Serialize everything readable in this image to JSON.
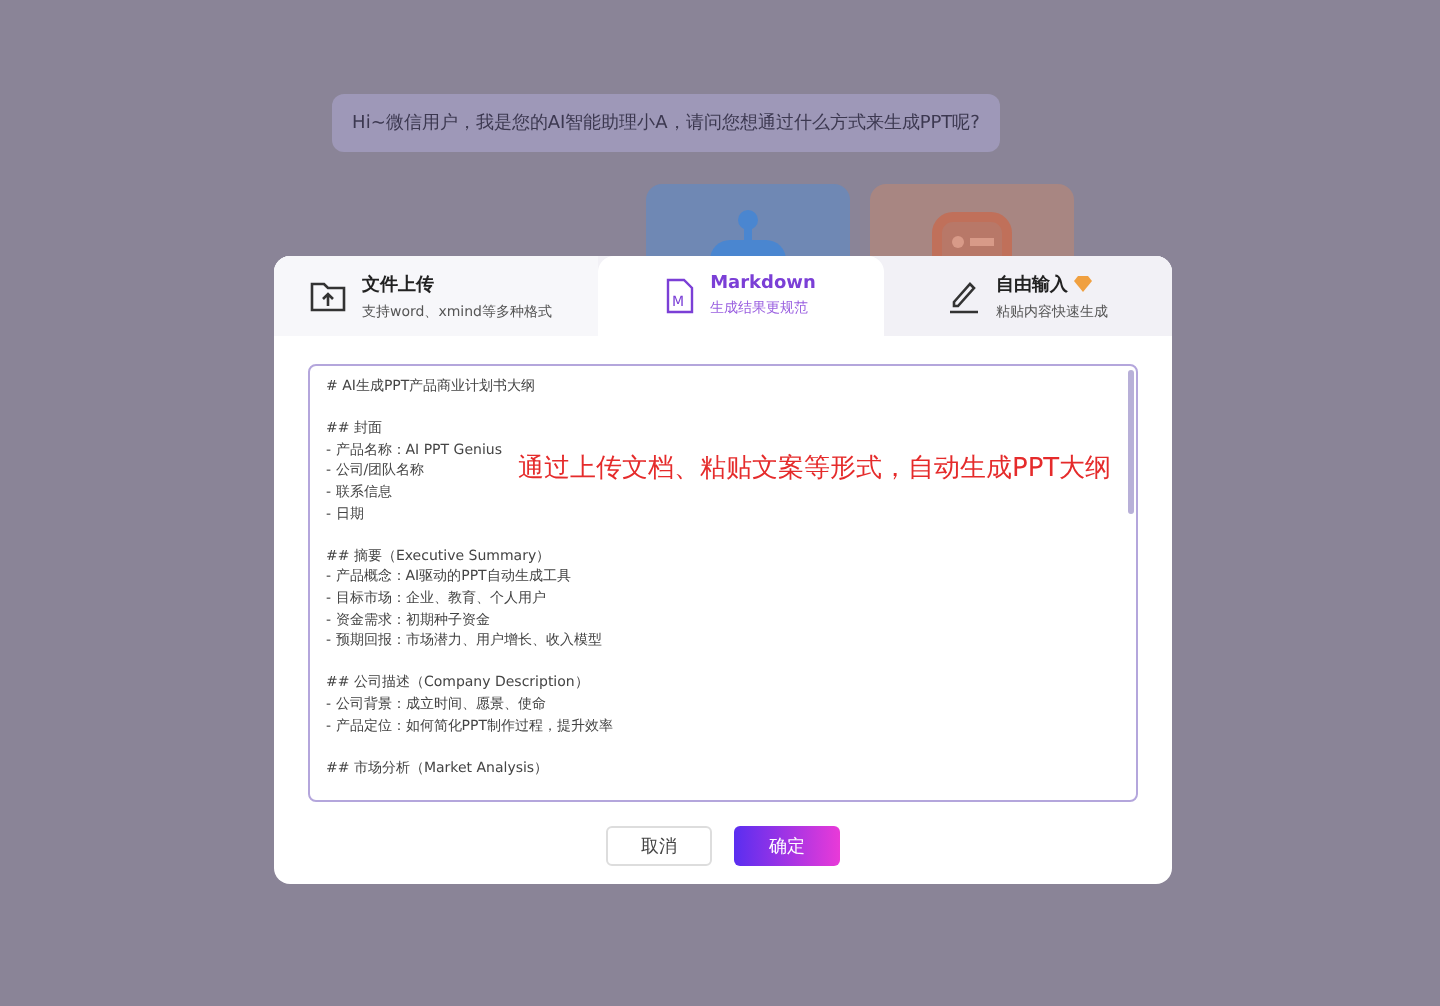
{
  "greeting": "Hi~微信用户，我是您的AI智能助理小A，请问您想通过什么方式来生成PPT呢?",
  "tabs": [
    {
      "kind": "upload",
      "title": "文件上传",
      "subtitle": "支持word、xmind等多种格式",
      "selected": false,
      "premium": false
    },
    {
      "kind": "markdown",
      "icon_letter": "M",
      "title": "Markdown",
      "subtitle": "生成结果更规范",
      "selected": true,
      "premium": false
    },
    {
      "kind": "pen",
      "title": "自由输入",
      "subtitle": "粘贴内容快速生成",
      "selected": false,
      "premium": true
    }
  ],
  "editor_blocks": [
    [
      "# AI生成PPT产品商业计划书大纲"
    ],
    [
      "## 封面",
      "- 产品名称：AI PPT Genius",
      "- 公司/团队名称",
      "- 联系信息",
      "- 日期"
    ],
    [
      "## 摘要（Executive Summary）",
      "- 产品概念：AI驱动的PPT自动生成工具",
      "- 目标市场：企业、教育、个人用户",
      "- 资金需求：初期种子资金",
      "- 预期回报：市场潜力、用户增长、收入模型"
    ],
    [
      "## 公司描述（Company Description）",
      "- 公司背景：成立时间、愿景、使命",
      "- 产品定位：如何简化PPT制作过程，提升效率"
    ],
    [
      "## 市场分析（Market Analysis）"
    ]
  ],
  "annotation": "通过上传文档、粘贴文案等形式，自动生成PPT大纲",
  "buttons": [
    {
      "kind": "cancel",
      "label": "取消"
    },
    {
      "kind": "confirm",
      "label": "确定"
    }
  ]
}
